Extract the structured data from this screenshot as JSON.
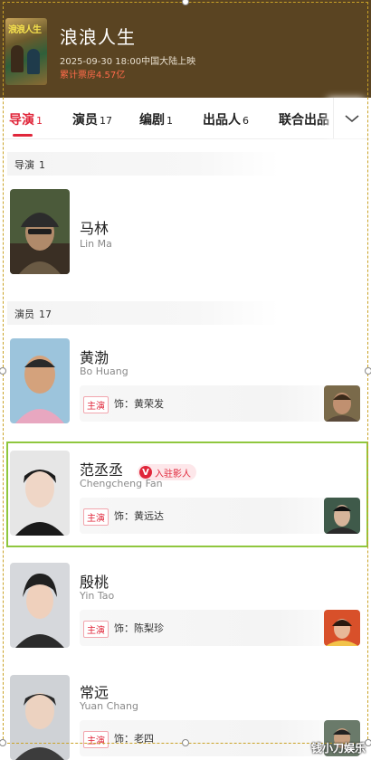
{
  "movie": {
    "title": "浪浪人生",
    "release": "2025-09-30 18:00中国大陆上映",
    "box_office": "累计票房4.57亿",
    "poster_text": "浪浪人生"
  },
  "tabs": [
    {
      "label": "导演",
      "count": "1",
      "active": true
    },
    {
      "label": "演员",
      "count": "17",
      "active": false
    },
    {
      "label": "编剧",
      "count": "1",
      "active": false
    },
    {
      "label": "出品人",
      "count": "6",
      "active": false
    },
    {
      "label": "联合出品",
      "count": "",
      "active": false
    }
  ],
  "sections": {
    "director": {
      "label": "导演",
      "count": "1"
    },
    "actors": {
      "label": "演员",
      "count": "17"
    }
  },
  "director": {
    "name": "马林",
    "english": "Lin Ma"
  },
  "actors": [
    {
      "name": "黄渤",
      "english": "Bo Huang",
      "role_tag": "主演",
      "role": "饰：黄荣发"
    },
    {
      "name": "范丞丞",
      "english": "Chengcheng Fan",
      "role_tag": "主演",
      "role": "饰：黄远达",
      "badge_icon": "V",
      "badge": "入驻影人"
    },
    {
      "name": "殷桃",
      "english": "Yin Tao",
      "role_tag": "主演",
      "role": "饰：陈梨珍"
    },
    {
      "name": "常远",
      "english": "Yuan Chang",
      "role_tag": "主演",
      "role": "饰：老四"
    }
  ],
  "watermark": "钱小刀娱乐",
  "colors": {
    "header_bg": "#5a4422",
    "accent": "#e0263a",
    "selection": "#8fc73e"
  },
  "icons": {
    "more_tabs": "chevron-down-icon"
  }
}
